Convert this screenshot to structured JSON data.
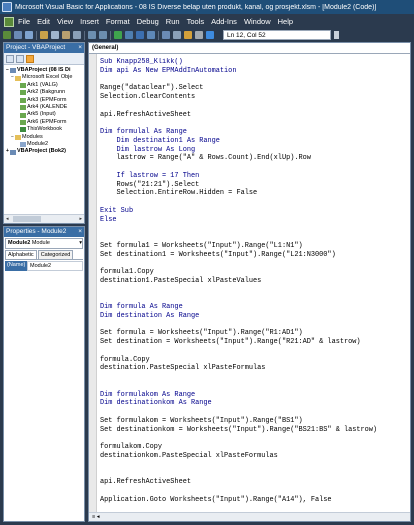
{
  "window": {
    "title": "Microsoft Visual Basic for Applications - 08 IS Diverse belap uten produkt, kanal, og prosjekt.xlsm - [Module2 (Code)]"
  },
  "menu": [
    "File",
    "Edit",
    "View",
    "Insert",
    "Format",
    "Debug",
    "Run",
    "Tools",
    "Add-Ins",
    "Window",
    "Help"
  ],
  "toolbar": {
    "position": "Ln 12, Col 52"
  },
  "project": {
    "title": "Project - VBAProject",
    "close": "×",
    "tree": [
      {
        "label": "VBAProject (08 IS Di",
        "indent": 0,
        "icon": "proj",
        "toggle": "−",
        "bold": true
      },
      {
        "label": "Microsoft Excel Obje",
        "indent": 1,
        "icon": "folder",
        "toggle": "−",
        "bold": false
      },
      {
        "label": "Ark1 (VALG)",
        "indent": 2,
        "icon": "sheet",
        "toggle": "",
        "bold": false
      },
      {
        "label": "Ark2 (Bakgrunn",
        "indent": 2,
        "icon": "sheet",
        "toggle": "",
        "bold": false
      },
      {
        "label": "Ark3 (EPMForm",
        "indent": 2,
        "icon": "sheet",
        "toggle": "",
        "bold": false
      },
      {
        "label": "Ark4 (KALENDE",
        "indent": 2,
        "icon": "sheet",
        "toggle": "",
        "bold": false
      },
      {
        "label": "Ark5 (Input)",
        "indent": 2,
        "icon": "sheet",
        "toggle": "",
        "bold": false
      },
      {
        "label": "Ark6 (EPMForm",
        "indent": 2,
        "icon": "sheet",
        "toggle": "",
        "bold": false
      },
      {
        "label": "ThisWorkbook",
        "indent": 2,
        "icon": "wb",
        "toggle": "",
        "bold": false
      },
      {
        "label": "Modules",
        "indent": 1,
        "icon": "folder",
        "toggle": "−",
        "bold": false
      },
      {
        "label": "Module2",
        "indent": 2,
        "icon": "mod",
        "toggle": "",
        "bold": false
      },
      {
        "label": "VBAProject (Bok2)",
        "indent": 0,
        "icon": "proj",
        "toggle": "+",
        "bold": true
      }
    ],
    "scroll_left": "◂",
    "scroll_right": "▸"
  },
  "properties": {
    "title": "Properties - Module2",
    "close": "×",
    "object_name": "Module2",
    "object_type": "Module",
    "dropdown": "▾",
    "tabs": [
      "Alphabetic",
      "Categorized"
    ],
    "rows": [
      {
        "key": "(Name)",
        "value": "Module2"
      }
    ]
  },
  "code_window": {
    "procedure_combo": "(General)",
    "lines": [
      [
        {
          "t": "Sub Knapp258_Klikk()",
          "k": true
        }
      ],
      [
        {
          "t": "Dim api As New EPMAddInAutomation",
          "k": true
        }
      ],
      [],
      [
        {
          "t": "Range(\"dataclear\").Select",
          "k": false
        }
      ],
      [
        {
          "t": "Selection.ClearContents",
          "k": false
        }
      ],
      [],
      [
        {
          "t": "api.RefreshActiveSheet",
          "k": false
        }
      ],
      [],
      [
        {
          "t": "Dim formulal As Range",
          "k": true
        }
      ],
      [
        {
          "t": "    Dim destination1 As Range",
          "k": true
        }
      ],
      [
        {
          "t": "    Dim lastrow As Long",
          "k": true
        }
      ],
      [
        {
          "t": "    lastrow = Range(\"A\" & Rows.Count).End(xlUp).Row",
          "k": false
        }
      ],
      [],
      [
        {
          "t": "    If lastrow = 17 Then",
          "k": true
        }
      ],
      [
        {
          "t": "    Rows(\"21:21\").Select",
          "k": false
        }
      ],
      [
        {
          "t": "    Selection.EntireRow.Hidden = False",
          "k": false
        }
      ],
      [],
      [
        {
          "t": "Exit Sub",
          "k": true
        }
      ],
      [
        {
          "t": "Else",
          "k": true
        }
      ],
      [],
      [],
      [
        {
          "t": "Set formula1 = Worksheets(\"Input\").Range(\"L1:N1\")",
          "k": false
        }
      ],
      [
        {
          "t": "Set destination1 = Worksheets(\"Input\").Range(\"L21:N3000\")",
          "k": false
        }
      ],
      [],
      [
        {
          "t": "formula1.Copy",
          "k": false
        }
      ],
      [
        {
          "t": "destination1.PasteSpecial xlPasteValues",
          "k": false
        }
      ],
      [],
      [],
      [
        {
          "t": "Dim formula As Range",
          "k": true
        }
      ],
      [
        {
          "t": "Dim destination As Range",
          "k": true
        }
      ],
      [],
      [
        {
          "t": "Set formula = Worksheets(\"Input\").Range(\"R1:AD1\")",
          "k": false
        }
      ],
      [
        {
          "t": "Set destination = Worksheets(\"Input\").Range(\"R21:AD\" & lastrow)",
          "k": false
        }
      ],
      [],
      [
        {
          "t": "formula.Copy",
          "k": false
        }
      ],
      [
        {
          "t": "destination.PasteSpecial xlPasteFormulas",
          "k": false
        }
      ],
      [],
      [],
      [
        {
          "t": "Dim formulakom As Range",
          "k": true
        }
      ],
      [
        {
          "t": "Dim destinationkom As Range",
          "k": true
        }
      ],
      [],
      [
        {
          "t": "Set formulakom = Worksheets(\"Input\").Range(\"BS1\")",
          "k": false
        }
      ],
      [
        {
          "t": "Set destinationkom = Worksheets(\"Input\").Range(\"BS21:BS\" & lastrow)",
          "k": false
        }
      ],
      [],
      [
        {
          "t": "formulakom.Copy",
          "k": false
        }
      ],
      [
        {
          "t": "destinationkom.PasteSpecial xlPasteFormulas",
          "k": false
        }
      ],
      [],
      [],
      [
        {
          "t": "api.RefreshActiveSheet",
          "k": false
        }
      ],
      [],
      [
        {
          "t": "Application.Goto Worksheets(\"Input\").Range(\"A14\"), False",
          "k": false
        }
      ]
    ],
    "status_text": "≡ ◂"
  },
  "colors": {
    "title_bar": "#1f4e78",
    "chrome": "#2b3a4e",
    "keyword": "#00008b",
    "panel_title": "#3a6ea5"
  }
}
